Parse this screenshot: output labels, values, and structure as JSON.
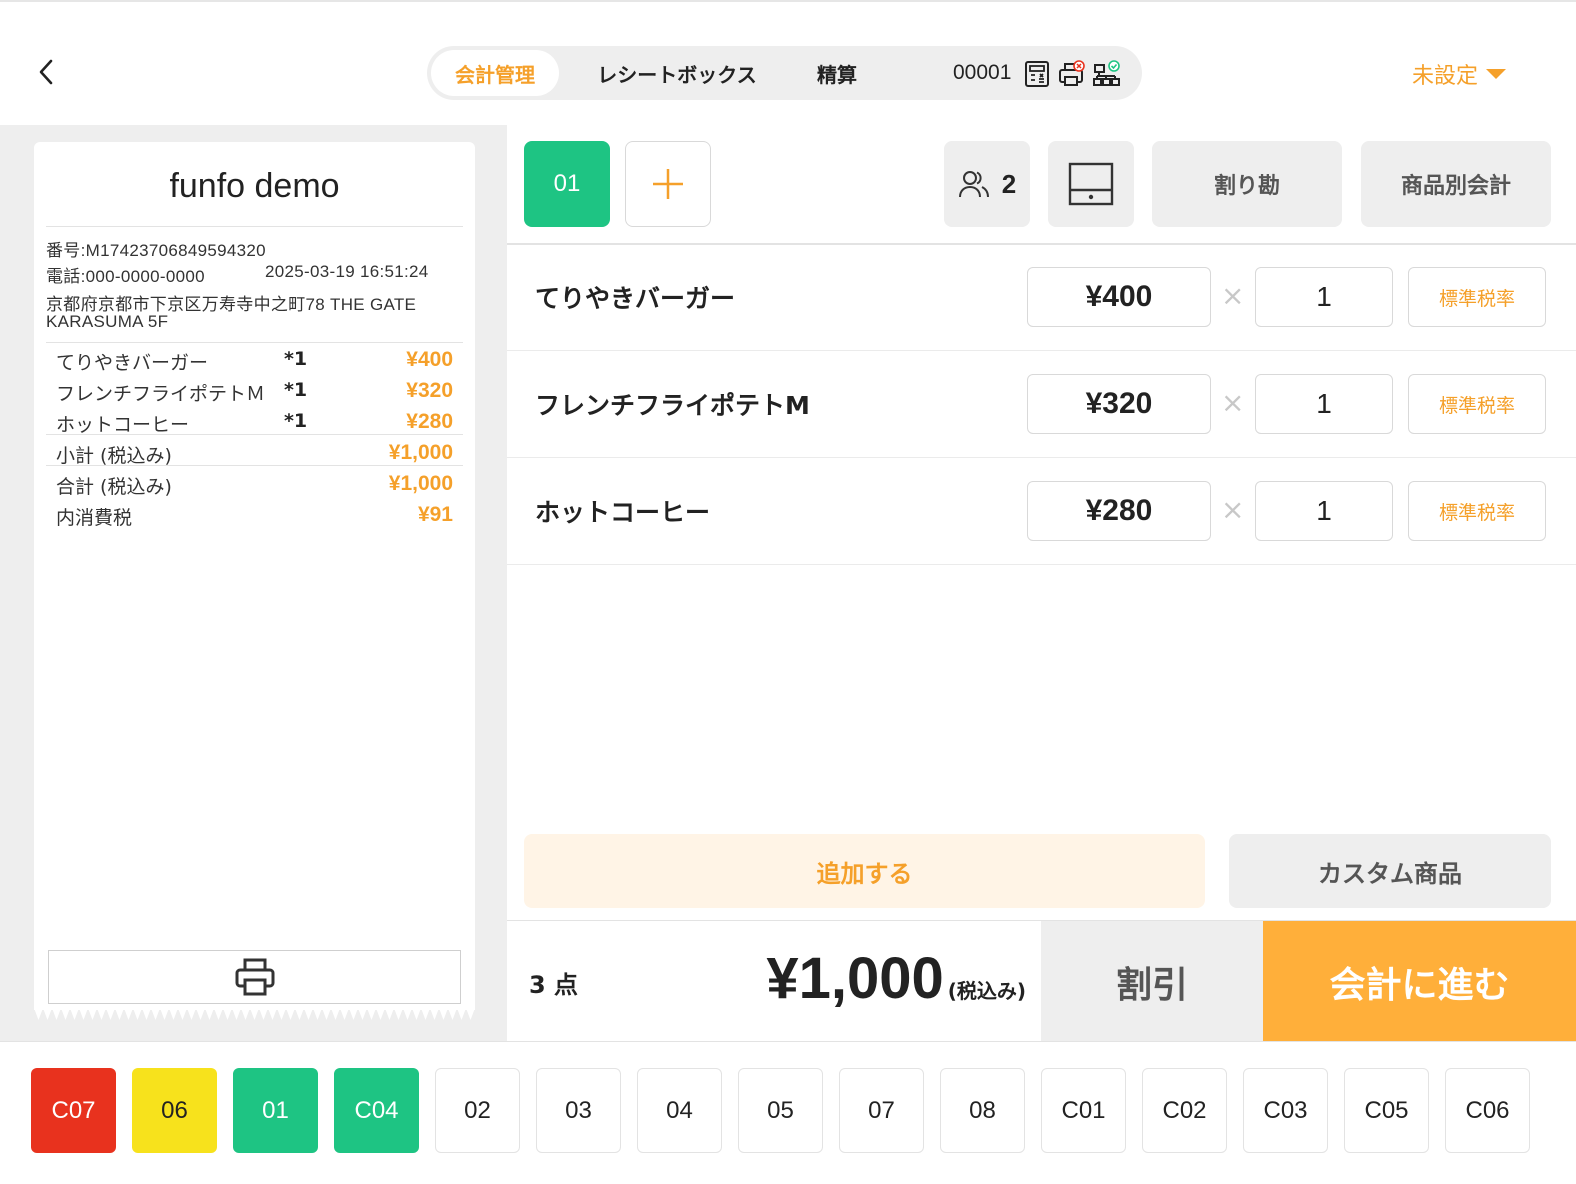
{
  "header": {
    "tabs": [
      {
        "label": "会計管理",
        "active": true
      },
      {
        "label": "レシートボックス",
        "active": false
      },
      {
        "label": "精算",
        "active": false
      }
    ],
    "register_number": "00001",
    "status_selector": "未設定",
    "accent_color": "#f5a02a"
  },
  "receipt": {
    "shop_name": "funfo demo",
    "number": "番号:M17423706849594320",
    "phone": "電話:000-0000-0000",
    "datetime": "2025-03-19 16:51:24",
    "address_line1": "京都府京都市下京区万寿寺中之町78 THE GATE",
    "address_line2": "KARASUMA 5F",
    "lines": [
      {
        "name": "てりやきバーガー",
        "qty": "*1",
        "price": "¥400"
      },
      {
        "name": "フレンチフライポテトＭ",
        "qty": "*1",
        "price": "¥320"
      },
      {
        "name": "ホットコーヒー",
        "qty": "*1",
        "price": "¥280"
      }
    ],
    "subtotal_label": "小計 (税込み)",
    "subtotal": "¥1,000",
    "total_label": "合計 (税込み)",
    "total": "¥1,000",
    "tax_label": "内消費税",
    "tax": "¥91"
  },
  "order": {
    "active_table": "01",
    "guests": "2",
    "split_label": "割り勘",
    "by_item_label": "商品別会計",
    "items": [
      {
        "name": "てりやきバーガー",
        "price": "¥400",
        "qty": "1",
        "tax": "標準税率"
      },
      {
        "name": "フレンチフライポテトM",
        "price": "¥320",
        "qty": "1",
        "tax": "標準税率"
      },
      {
        "name": "ホットコーヒー",
        "price": "¥280",
        "qty": "1",
        "tax": "標準税率"
      }
    ],
    "times_symbol": "×",
    "add_label": "追加する",
    "custom_label": "カスタム商品",
    "count_label": "3 点",
    "total_amount": "¥1,000",
    "total_suffix": "(税込み)",
    "discount_label": "割引",
    "checkout_label": "会計に進む"
  },
  "tables": [
    {
      "label": "C07",
      "color": "#e8321e",
      "text_color": "#ffffff"
    },
    {
      "label": "06",
      "color": "#f7e21c",
      "text_color": "#222222"
    },
    {
      "label": "01",
      "color": "#1ec483",
      "text_color": "#ffffff"
    },
    {
      "label": "C04",
      "color": "#1ec483",
      "text_color": "#ffffff"
    },
    {
      "label": "02",
      "color": "#ffffff",
      "text_color": "#222222"
    },
    {
      "label": "03",
      "color": "#ffffff",
      "text_color": "#222222"
    },
    {
      "label": "04",
      "color": "#ffffff",
      "text_color": "#222222"
    },
    {
      "label": "05",
      "color": "#ffffff",
      "text_color": "#222222"
    },
    {
      "label": "07",
      "color": "#ffffff",
      "text_color": "#222222"
    },
    {
      "label": "08",
      "color": "#ffffff",
      "text_color": "#222222"
    },
    {
      "label": "C01",
      "color": "#ffffff",
      "text_color": "#222222"
    },
    {
      "label": "C02",
      "color": "#ffffff",
      "text_color": "#222222"
    },
    {
      "label": "C03",
      "color": "#ffffff",
      "text_color": "#222222"
    },
    {
      "label": "C05",
      "color": "#ffffff",
      "text_color": "#222222"
    },
    {
      "label": "C06",
      "color": "#ffffff",
      "text_color": "#222222"
    }
  ]
}
